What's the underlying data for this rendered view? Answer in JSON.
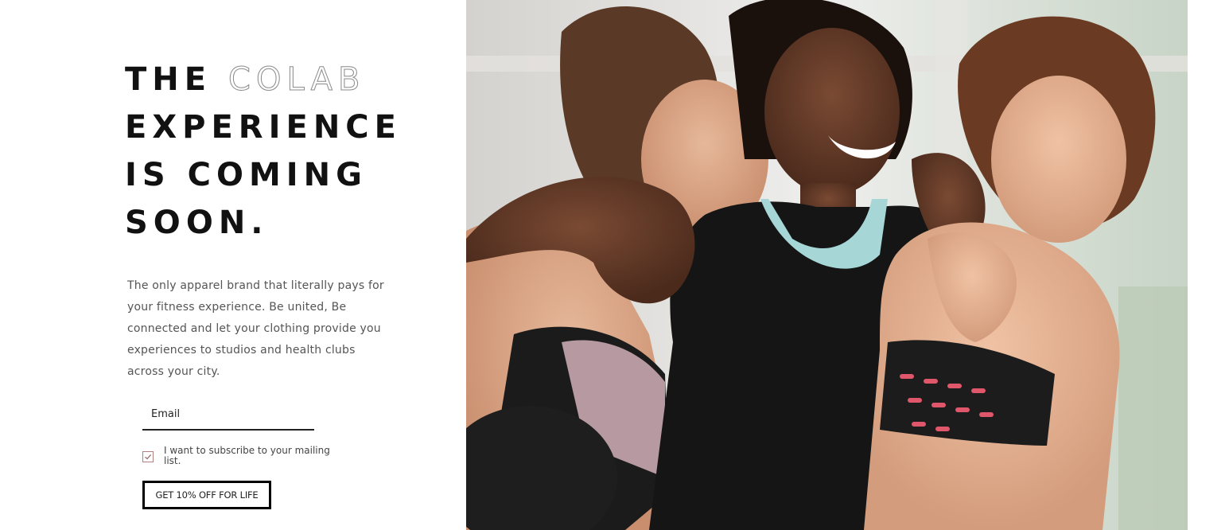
{
  "hero": {
    "headline": {
      "word1": "THE",
      "word2_outline": "COLAB",
      "line2": "EXPERIENCE",
      "line3": "IS COMING",
      "line4": "SOON."
    },
    "intro": "The only apparel brand that literally pays for your fitness experience. Be united, Be connected and let your clothing provide you experiences to studios and health clubs across your city."
  },
  "signup": {
    "email_placeholder": "Email",
    "email_value": "",
    "subscribe_label": "I want to subscribe to your mailing list.",
    "subscribe_checked": true,
    "cta_label": "GET 10% OFF FOR LIFE"
  },
  "photo": {
    "description_icon": "photo-three-women-laughing"
  },
  "colors": {
    "text_dark": "#111111",
    "text_body": "#555555",
    "checkbox_accent": "#b08080",
    "cta_border": "#000000"
  }
}
